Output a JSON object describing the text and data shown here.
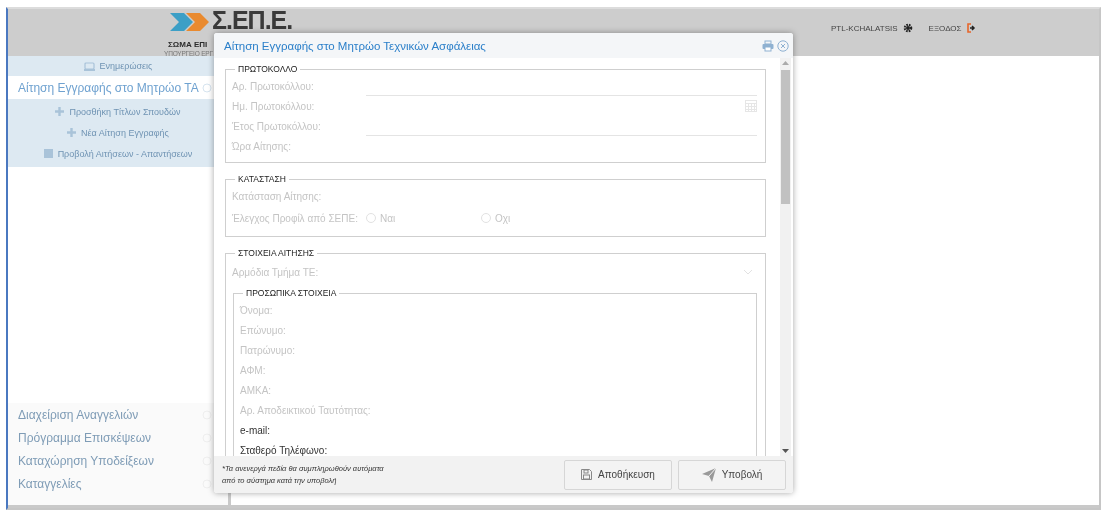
{
  "header": {
    "logo": {
      "title": "Σ.ΕΠ.Ε.",
      "subtitle": "ΣΩΜΑ ΕΠΙ",
      "ministry": "ΥΠΟΥΡΓΕΙΟ ΕΡΓ"
    },
    "user": "PTL-KCHALATSIS",
    "logout": "ΕΞΟΔΟΣ"
  },
  "sidebar": {
    "items": [
      {
        "label": "Ενημερώσεις",
        "kind": "header",
        "selected": false
      },
      {
        "label": "Αίτηση Εγγραφής στο Μητρώο ΤΑ",
        "kind": "menu",
        "selected": true,
        "children": [
          {
            "label": "Προσθήκη Τίτλων Σπουδών",
            "kind": "add"
          },
          {
            "label": "Νέα Αίτηση Εγγραφής",
            "kind": "add"
          },
          {
            "label": "Προβολή Αιτήσεων - Απαντήσεων",
            "kind": "list"
          }
        ]
      },
      {
        "label": "Διαχείριση Αναγγελιών",
        "kind": "menu",
        "selected": false
      },
      {
        "label": "Πρόγραμμα Επισκέψεων",
        "kind": "menu",
        "selected": false
      },
      {
        "label": "Καταχώρηση Υποδείξεων",
        "kind": "menu",
        "selected": false
      },
      {
        "label": "Καταγγελίες",
        "kind": "menu",
        "selected": false
      }
    ]
  },
  "dialog": {
    "title": "Αίτηση Εγγραφής στο Μητρώο Τεχνικών Ασφάλειας",
    "sections": [
      {
        "legend": "ΠΡΩΤΟΚΟΛΛΟ",
        "fields": [
          {
            "label": "Αρ. Πρωτοκόλλου:",
            "kind": "text",
            "disabled": true
          },
          {
            "label": "Ημ. Πρωτοκόλλου:",
            "kind": "date",
            "disabled": true
          },
          {
            "label": "Έτος Πρωτοκόλλου:",
            "kind": "text",
            "disabled": true
          },
          {
            "label": "Ώρα Αίτησης:",
            "kind": "plain",
            "disabled": true
          }
        ]
      },
      {
        "legend": "ΚΑΤΑΣΤΑΣΗ",
        "fields": [
          {
            "label": "Κατάσταση Αίτησης:",
            "kind": "plain",
            "disabled": true
          },
          {
            "label": "Έλεγχος Προφίλ από ΣΕΠΕ:",
            "kind": "radio",
            "disabled": true,
            "options": [
              {
                "label": "Ναι",
                "selected": false
              },
              {
                "label": "Οχι",
                "selected": false
              }
            ]
          }
        ]
      },
      {
        "legend": "ΣΤΟΙΧΕΙΑ ΑΙΤΗΣΗΣ",
        "fields": [
          {
            "label": "Αρμόδια Τμήμα ΤΕ:",
            "kind": "select",
            "disabled": true
          },
          {
            "kind": "group",
            "legend": "ΠΡΟΣΩΠΙΚΑ ΣΤΟΙΧΕΙΑ",
            "fields": [
              {
                "label": "Όνομα:",
                "kind": "plain",
                "disabled": true
              },
              {
                "label": "Επώνυμο:",
                "kind": "plain",
                "disabled": true
              },
              {
                "label": "Πατρώνυμο:",
                "kind": "plain",
                "disabled": true
              },
              {
                "label": "ΑΦΜ:",
                "kind": "plain",
                "disabled": true
              },
              {
                "label": "ΑΜΚΑ:",
                "kind": "plain",
                "disabled": true
              },
              {
                "label": "Αρ. Αποδεικτικού Ταυτότητας:",
                "kind": "plain",
                "disabled": true
              },
              {
                "label": "e-mail:",
                "kind": "plain",
                "disabled": false
              },
              {
                "label": "Σταθερό Τηλέφωνο:",
                "kind": "plain",
                "disabled": false
              }
            ]
          }
        ]
      }
    ],
    "note": [
      "*Τα ανενεργά πεδία θα συμπληρωθούν αυτόματα",
      "από το σύστημα κατά την υποβολή"
    ],
    "buttons": [
      {
        "label": "Αποθήκευση",
        "kind": "save"
      },
      {
        "label": "Υποβολή",
        "kind": "submit"
      }
    ]
  }
}
